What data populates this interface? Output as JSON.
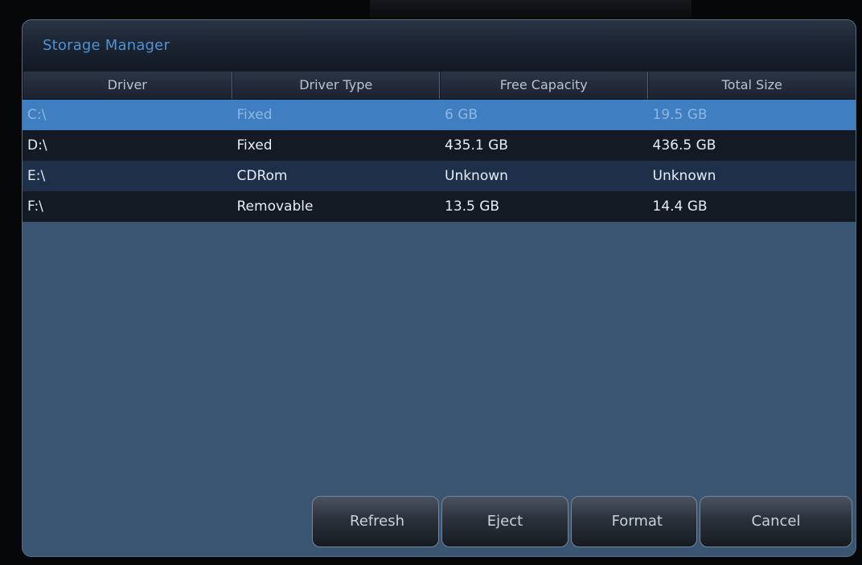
{
  "dialog": {
    "title": "Storage Manager"
  },
  "table": {
    "columns": [
      "Driver",
      "Driver Type",
      "Free Capacity",
      "Total Size"
    ],
    "rows": [
      {
        "driver": "C:\\",
        "type": "Fixed",
        "free": "6 GB",
        "total": "19.5 GB",
        "selected": true
      },
      {
        "driver": "D:\\",
        "type": "Fixed",
        "free": "435.1 GB",
        "total": "436.5 GB",
        "selected": false
      },
      {
        "driver": "E:\\",
        "type": "CDRom",
        "free": "Unknown",
        "total": "Unknown",
        "selected": false
      },
      {
        "driver": "F:\\",
        "type": "Removable",
        "free": "13.5 GB",
        "total": "14.4 GB",
        "selected": false
      }
    ]
  },
  "buttons": {
    "refresh": "Refresh",
    "eject": "Eject",
    "format": "Format",
    "cancel": "Cancel"
  },
  "colors": {
    "title": "#4c93d8",
    "selected_row": "#3f7fc1",
    "panel": "#3a5572"
  }
}
